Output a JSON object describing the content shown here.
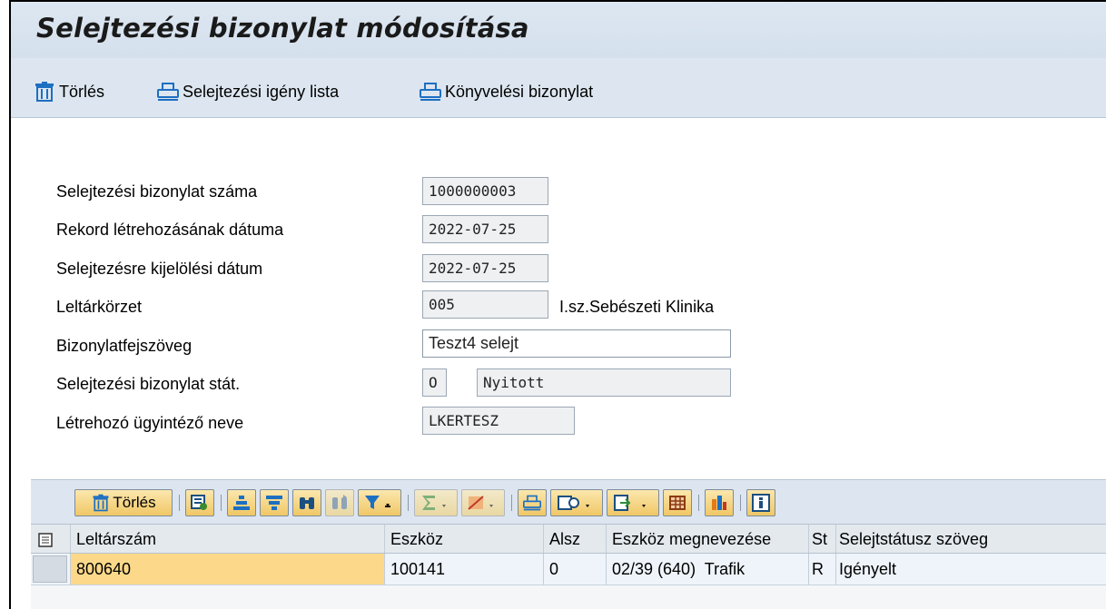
{
  "title": "Selejtezési bizonylat módosítása",
  "toolbar": {
    "delete_label": "Törlés",
    "request_list_label": "Selejtezési igény lista",
    "posting_doc_label": "Könyvelési bizonylat"
  },
  "form": {
    "doc_number": {
      "label": "Selejtezési bizonylat száma",
      "value": "1000000003"
    },
    "created_date": {
      "label": "Rekord létrehozásának dátuma",
      "value": "2022-07-25"
    },
    "marked_date": {
      "label": "Selejtezésre kijelölési dátum",
      "value": "2022-07-25"
    },
    "inventory_area": {
      "label": "Leltárkörzet",
      "value": "005",
      "description": "I.sz.Sebészeti Klinika"
    },
    "header_text": {
      "label": "Bizonylatfejszöveg",
      "value": "Teszt4 selejt"
    },
    "doc_status": {
      "label": "Selejtezési bizonylat stát.",
      "code": "O",
      "text": "Nyitott"
    },
    "creator": {
      "label": "Létrehozó ügyintéző neve",
      "value": "LKERTESZ"
    }
  },
  "alv": {
    "delete_label": "Törlés",
    "columns": [
      "Leltárszám",
      "Eszköz",
      "Alsz",
      "Eszköz megnevezése",
      "St",
      "Selejtstátusz szöveg"
    ],
    "rows": [
      [
        "800640",
        "100141",
        "0",
        "02/39 (640)  Trafik",
        "R",
        "Igényelt"
      ]
    ]
  }
}
